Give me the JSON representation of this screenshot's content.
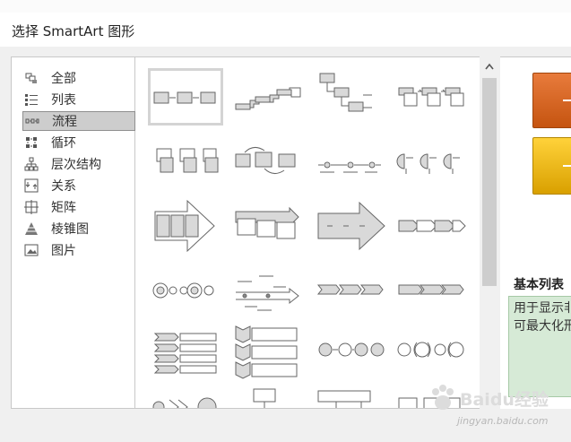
{
  "dialog": {
    "title": "选择 SmartArt 图形"
  },
  "categories": [
    {
      "label": "全部",
      "icon": "all-icon",
      "selected": false
    },
    {
      "label": "列表",
      "icon": "list-icon",
      "selected": false
    },
    {
      "label": "流程",
      "icon": "process-icon",
      "selected": true
    },
    {
      "label": "循环",
      "icon": "cycle-icon",
      "selected": false
    },
    {
      "label": "层次结构",
      "icon": "hierarchy-icon",
      "selected": false
    },
    {
      "label": "关系",
      "icon": "relationship-icon",
      "selected": false
    },
    {
      "label": "矩阵",
      "icon": "matrix-icon",
      "selected": false
    },
    {
      "label": "棱锥图",
      "icon": "pyramid-icon",
      "selected": false
    },
    {
      "label": "图片",
      "icon": "picture-icon",
      "selected": false
    }
  ],
  "gallery": {
    "rows": 6,
    "columns": 4,
    "selected_index": 0,
    "items": [
      "basic-process-thumbnail",
      "step-up-process-thumbnail",
      "descending-process-thumbnail",
      "accent-process-thumbnail",
      "picture-accent-process-thumbnail",
      "alternating-flow-thumbnail",
      "continuous-arrow-thumbnail",
      "process-arrows-thumbnail",
      "arrow-process-thumbnail",
      "staggered-process-thumbnail",
      "upward-arrow-thumbnail",
      "circle-arrow-process-thumbnail",
      "circle-process-thumbnail",
      "timeline-thumbnail",
      "chevron-process-thumbnail",
      "basic-chevron-thumbnail",
      "chevron-list-thumbnail",
      "vertical-chevron-list-thumbnail",
      "circular-connector-thumbnail",
      "bracket-process-thumbnail",
      "picture-process-thumbnail",
      "funnel-thumbnail",
      "segmented-process-thumbnail",
      "tab-process-thumbnail"
    ]
  },
  "preview": {
    "title": "基本列表",
    "description_lines": [
      "用于显示非",
      "可最大化形"
    ]
  },
  "watermark": {
    "text": "Baidu经验",
    "url": "jingyan.baidu.com"
  },
  "colors": {
    "accent_orange": "#e87b3c",
    "accent_yellow": "#ffd23a",
    "desc_bg": "#d6ead6"
  }
}
